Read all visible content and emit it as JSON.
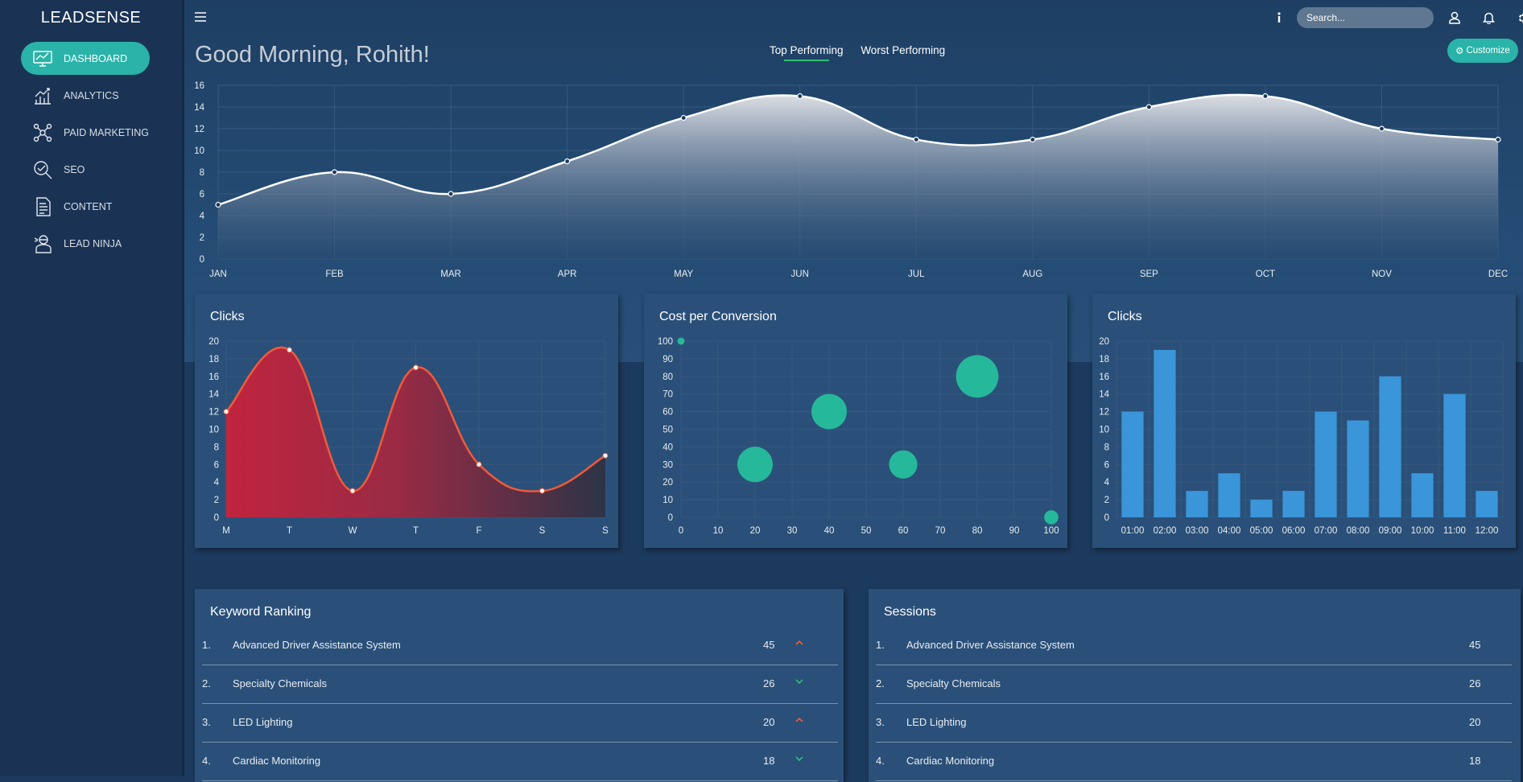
{
  "sidebar": {
    "logo": "LEADSENSE",
    "items": [
      {
        "label": "DASHBOARD",
        "icon": "monitor-icon",
        "active": true
      },
      {
        "label": "ANALYTICS",
        "icon": "analytics-icon",
        "active": false
      },
      {
        "label": "PAID MARKETING",
        "icon": "network-icon",
        "active": false
      },
      {
        "label": "SEO",
        "icon": "seo-icon",
        "active": false
      },
      {
        "label": "CONTENT",
        "icon": "document-icon",
        "active": false
      },
      {
        "label": "LEAD NINJA",
        "icon": "ninja-icon",
        "active": false
      }
    ]
  },
  "header": {
    "greeting": "Good Morning, Rohith!",
    "tabs": [
      {
        "label": "Top Performing",
        "active": true
      },
      {
        "label": "Worst Performing",
        "active": false
      }
    ],
    "search_placeholder": "Search...",
    "customize_label": "Customize",
    "icons": [
      "info-icon",
      "user-icon",
      "bell-icon",
      "gear-icon"
    ]
  },
  "colors": {
    "accent": "#2ab3a8",
    "bubble": "#26b89a",
    "bar": "#3b95d9",
    "line_red": "#f05a3a",
    "arrow_up": "#f05a3a",
    "arrow_down": "#29c173"
  },
  "chart_data": [
    {
      "type": "area",
      "categories": [
        "JAN",
        "FEB",
        "MAR",
        "APR",
        "MAY",
        "JUN",
        "JUL",
        "AUG",
        "SEP",
        "OCT",
        "NOV",
        "DEC"
      ],
      "values": [
        5,
        8,
        6,
        9,
        13,
        15,
        11,
        11,
        14,
        15,
        12,
        11
      ],
      "ylim": [
        0,
        16
      ],
      "yticks": [
        0,
        2,
        4,
        6,
        8,
        10,
        12,
        14,
        16
      ],
      "grid": true
    },
    {
      "type": "area",
      "title": "Clicks",
      "categories": [
        "M",
        "T",
        "W",
        "T",
        "F",
        "S",
        "S"
      ],
      "values": [
        12,
        19,
        3,
        17,
        6,
        3,
        7
      ],
      "ylim": [
        0,
        20
      ],
      "yticks": [
        0,
        2,
        4,
        6,
        8,
        10,
        12,
        14,
        16,
        18,
        20
      ],
      "grid": true
    },
    {
      "type": "scatter",
      "title": "Cost per Conversion",
      "points": [
        {
          "x": 0,
          "y": 100,
          "r": 1
        },
        {
          "x": 20,
          "y": 30,
          "r": 5
        },
        {
          "x": 40,
          "y": 60,
          "r": 5
        },
        {
          "x": 60,
          "y": 30,
          "r": 4
        },
        {
          "x": 80,
          "y": 80,
          "r": 6
        },
        {
          "x": 100,
          "y": 0,
          "r": 2
        }
      ],
      "xlim": [
        0,
        100
      ],
      "ylim": [
        0,
        100
      ],
      "xticks": [
        0,
        10,
        20,
        30,
        40,
        50,
        60,
        70,
        80,
        90,
        100
      ],
      "yticks": [
        0,
        10,
        20,
        30,
        40,
        50,
        60,
        70,
        80,
        90,
        100
      ],
      "grid": true
    },
    {
      "type": "bar",
      "title": "Clicks",
      "categories": [
        "01:00",
        "02:00",
        "03:00",
        "04:00",
        "05:00",
        "06:00",
        "07:00",
        "08:00",
        "09:00",
        "10:00",
        "11:00",
        "12:00"
      ],
      "values": [
        12,
        19,
        3,
        5,
        2,
        3,
        12,
        11,
        16,
        5,
        14,
        3
      ],
      "ylim": [
        0,
        20
      ],
      "yticks": [
        0,
        2,
        4,
        6,
        8,
        10,
        12,
        14,
        16,
        18,
        20
      ],
      "grid": true
    }
  ],
  "keyword_ranking": {
    "title": "Keyword Ranking",
    "rows": [
      {
        "num": "1.",
        "name": "Advanced Driver Assistance System",
        "value": "45",
        "trend": "up"
      },
      {
        "num": "2.",
        "name": "Specialty Chemicals",
        "value": "26",
        "trend": "down"
      },
      {
        "num": "3.",
        "name": "LED Lighting",
        "value": "20",
        "trend": "up"
      },
      {
        "num": "4.",
        "name": "Cardiac Monitoring",
        "value": "18",
        "trend": "down"
      }
    ]
  },
  "sessions": {
    "title": "Sessions",
    "rows": [
      {
        "num": "1.",
        "name": "Advanced Driver Assistance System",
        "value": "45"
      },
      {
        "num": "2.",
        "name": "Specialty Chemicals",
        "value": "26"
      },
      {
        "num": "3.",
        "name": "LED Lighting",
        "value": "20"
      },
      {
        "num": "4.",
        "name": "Cardiac Monitoring",
        "value": "18"
      }
    ]
  }
}
